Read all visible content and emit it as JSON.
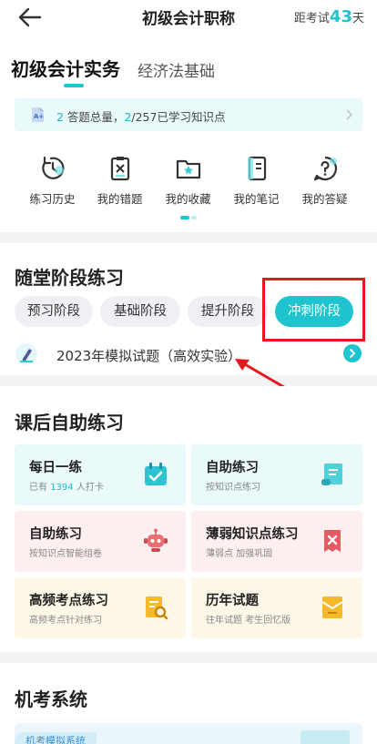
{
  "nav": {
    "title": "初级会计职称",
    "countdown_prefix": "距考试",
    "countdown_days": "43",
    "countdown_suffix": "天"
  },
  "subjects": [
    {
      "label": "初级会计实务",
      "active": true
    },
    {
      "label": "经济法基础",
      "active": false
    }
  ],
  "stats": {
    "answered_count": "2",
    "answered_label": " 答题总量，",
    "learned": "2",
    "total_points": "/257",
    "learned_label": "已学习知识点"
  },
  "quick_actions": [
    {
      "label": "练习历史",
      "icon": "history-icon"
    },
    {
      "label": "我的错题",
      "icon": "wrong-questions-icon"
    },
    {
      "label": "我的收藏",
      "icon": "favorites-folder-icon"
    },
    {
      "label": "我的笔记",
      "icon": "notes-icon"
    },
    {
      "label": "我的答疑",
      "icon": "qa-icon"
    }
  ],
  "stage_section": {
    "title": "随堂阶段练习",
    "stages": [
      {
        "label": "预习阶段",
        "active": false
      },
      {
        "label": "基础阶段",
        "active": false
      },
      {
        "label": "提升阶段",
        "active": false
      },
      {
        "label": "冲刺阶段",
        "active": true
      }
    ],
    "exam_title": "2023年模拟试题（高效实验）"
  },
  "self_practice": {
    "title": "课后自助练习",
    "cards": [
      {
        "title": "每日一练",
        "sub_prefix": "已有 ",
        "sub_count": "1394",
        "sub_suffix": " 人打卡",
        "icon": "calendar-check-icon"
      },
      {
        "title": "自助练习",
        "sub": "按知识点练习",
        "icon": "scroll-icon"
      },
      {
        "title": "自助练习",
        "sub": "按知识点智能组卷",
        "icon": "robot-icon"
      },
      {
        "title": "薄弱知识点练习",
        "sub": "薄弱点  加强巩固",
        "icon": "weak-point-icon"
      },
      {
        "title": "高频考点练习",
        "sub": "高频考点针对练习",
        "icon": "search-document-icon"
      },
      {
        "title": "历年试题",
        "sub": "往年试题  考生回忆版",
        "icon": "envelope-icon"
      }
    ]
  },
  "exam_system": {
    "title": "机考系统",
    "tag": "机考模拟系统"
  },
  "colors": {
    "accent": "#1fc4cf",
    "highlight": "#e5171f",
    "card_blue": "#eaf9fa",
    "card_pink": "#fdeff0",
    "card_yellow": "#fdf7e7"
  }
}
